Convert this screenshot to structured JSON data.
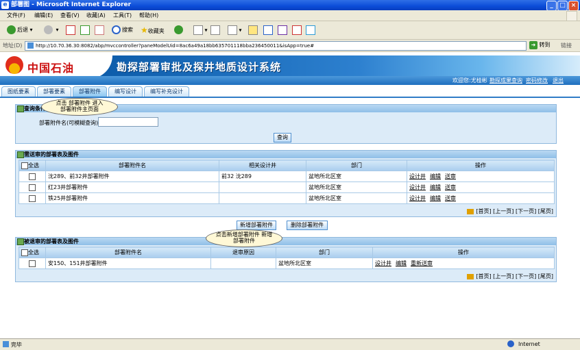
{
  "window": {
    "title": "部署图 - Microsoft Internet Explorer"
  },
  "menu": [
    "文件(F)",
    "编辑(E)",
    "查看(V)",
    "收藏(A)",
    "工具(T)",
    "帮助(H)"
  ],
  "toolbar": {
    "back": "后退",
    "search": "搜索",
    "favorites": "收藏夹"
  },
  "address": {
    "label": "地址(D)",
    "url": "http://10.70.36.30:8082/abp/mvccontroller?paneModelUid=8ac6a49a18bb635701118bba236450011&isApp=true#",
    "go": "转到",
    "links": "链接"
  },
  "brand": {
    "company": "中国石油",
    "system": "勘探部署审批及探井地质设计系统"
  },
  "userbar": [
    "欢迎您:尤桂彬",
    "勘探成果查询",
    "密码修改",
    "退出"
  ],
  "tabs": [
    "图纸要素",
    "部署要素",
    "部署附件",
    "编写设计",
    "编写补充设计"
  ],
  "active_tab": 2,
  "query": {
    "title": "查询条件",
    "label": "部署附件名(可模糊查询)",
    "value": "",
    "button": "查询"
  },
  "pending": {
    "title": "需送审的部署表及图件",
    "select_all": "全选",
    "columns": [
      "部署附件名",
      "相关设计井",
      "部门",
      "操作"
    ],
    "rows": [
      {
        "name": "沈289、前32井部署附件",
        "wells": "前32 沈289",
        "dept": "盆地所北区室"
      },
      {
        "name": "红23井部署附件",
        "wells": "",
        "dept": "盆地所北区室"
      },
      {
        "name": "铁25井部署附件",
        "wells": "",
        "dept": "盆地所北区室"
      }
    ],
    "actions": [
      "设计井",
      "编辑",
      "送审"
    ]
  },
  "pager": [
    "[首页]",
    "[上一页]",
    "[下一页]",
    "[尾页]"
  ],
  "buttons": {
    "add": "新增部署附件",
    "delete": "删除部署附件"
  },
  "rejected": {
    "title": "被退审的部署表及图件",
    "select_all": "全选",
    "columns": [
      "部署附件名",
      "退审原因",
      "部门",
      "操作"
    ],
    "rows": [
      {
        "name": "安150、151井部署附件",
        "reason": "",
        "dept": "盆地所北区室"
      }
    ],
    "actions": [
      "设计井",
      "编辑",
      "重新送审"
    ]
  },
  "callouts": {
    "tab_hint": [
      "点击 部署附件 进入",
      "部署附件主页面"
    ],
    "add_hint": [
      "点击新增部署附件 新增",
      "部署附件"
    ]
  },
  "status": {
    "left": "完毕",
    "zone": "Internet"
  },
  "colors": {
    "banner": "#1f6fbf",
    "panel": "#dcebf8",
    "accent": "#2f7bc6"
  }
}
